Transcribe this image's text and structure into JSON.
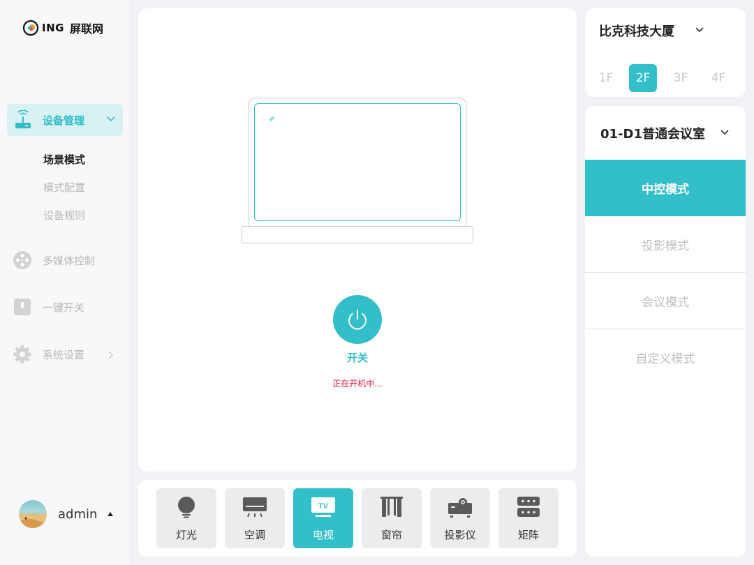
{
  "brand": {
    "logo_text": "ING",
    "name": "屏联网"
  },
  "sidebar": {
    "active_menu": {
      "label": "设备管理",
      "icon": "router-icon"
    },
    "submenu": [
      {
        "label": "场景模式",
        "selected": true
      },
      {
        "label": "模式配置",
        "selected": false
      },
      {
        "label": "设备规则",
        "selected": false
      }
    ],
    "menu": [
      {
        "label": "多媒体控制",
        "icon": "film-reel-icon"
      },
      {
        "label": "一键开关",
        "icon": "switch-icon"
      },
      {
        "label": "系统设置",
        "icon": "gear-icon"
      }
    ]
  },
  "user": {
    "name": "admin"
  },
  "display": {
    "device": "tv-icon",
    "power_label": "开关",
    "status": "正在开机中...",
    "status_color": "#e0102e"
  },
  "devices": [
    {
      "label": "灯光",
      "icon": "bulb-icon",
      "active": false
    },
    {
      "label": "空调",
      "icon": "air-conditioner-icon",
      "active": false
    },
    {
      "label": "电视",
      "icon": "tv-icon",
      "active": true,
      "badge": "TV"
    },
    {
      "label": "窗帘",
      "icon": "curtain-icon",
      "active": false
    },
    {
      "label": "投影仪",
      "icon": "projector-icon",
      "active": false
    },
    {
      "label": "矩阵",
      "icon": "matrix-icon",
      "active": false
    }
  ],
  "building": {
    "name": "比克科技大厦",
    "floors": [
      "1F",
      "2F",
      "3F",
      "4F"
    ],
    "selected_floor": "2F"
  },
  "room": {
    "name": "01-D1普通会议室",
    "modes": [
      "中控模式",
      "投影模式",
      "会议模式",
      "自定义模式"
    ],
    "selected_mode": "中控模式"
  },
  "colors": {
    "accent": "#33bfc9",
    "accent_light": "#d8f1f3",
    "alert": "#e0102e"
  }
}
